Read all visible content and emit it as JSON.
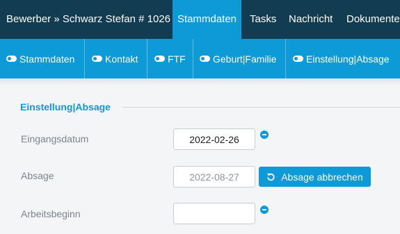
{
  "header": {
    "title": "Bewerber » Schwarz Stefan # 1026",
    "tabs": [
      {
        "label": "Stammdaten",
        "active": true
      },
      {
        "label": "Tasks",
        "active": false
      },
      {
        "label": "Nachricht",
        "active": false
      },
      {
        "label": "Dokumente",
        "active": false
      }
    ]
  },
  "subnav": {
    "items": [
      {
        "label": "Stammdaten",
        "icon": "toggle-icon"
      },
      {
        "label": "Kontakt",
        "icon": "toggle-icon"
      },
      {
        "label": "FTF",
        "icon": "toggle-icon"
      },
      {
        "label": "Geburt|Familie",
        "icon": "toggle-icon"
      },
      {
        "label": "Einstellung|Absage",
        "icon": "toggle-icon"
      }
    ]
  },
  "section": {
    "title": "Einstellung|Absage",
    "fields": [
      {
        "label": "Eingangsdatum",
        "value": "2022-02-26",
        "action_icon": "minus-circle-icon"
      },
      {
        "label": "Absage",
        "value": "2022-08-27",
        "button_label": "Absage abbrechen",
        "button_icon": "undo-icon"
      },
      {
        "label": "Arbeitsbeginn",
        "value": "",
        "action_icon": "minus-circle-icon"
      }
    ]
  },
  "colors": {
    "header_bg": "#123c52",
    "accent": "#0e9ad6",
    "page_bg": "#f4f5f7"
  }
}
